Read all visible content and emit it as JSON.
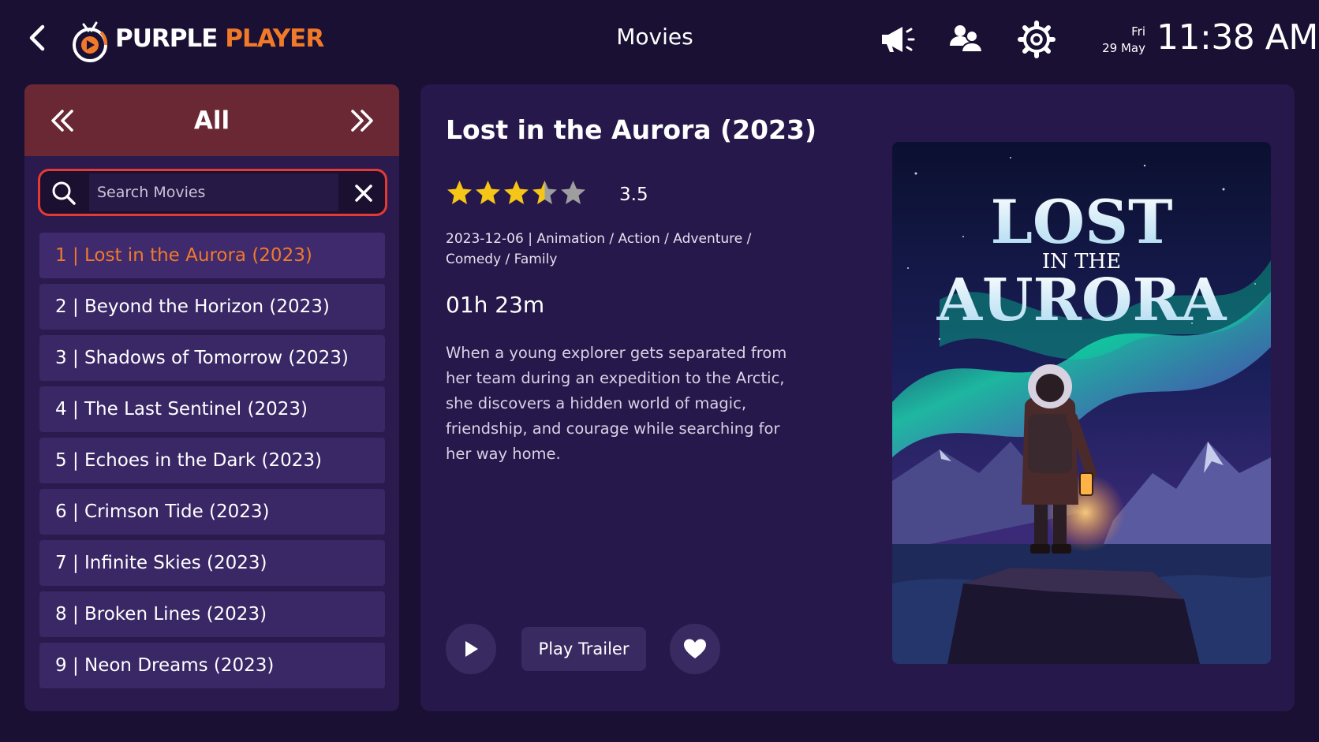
{
  "app": {
    "logo_part1": "PURPLE",
    "logo_part2": "PLAYER",
    "page_title": "Movies",
    "day": "Fri",
    "date": "29 May",
    "time": "11:38 AM",
    "icons": [
      "back-arrow-icon",
      "megaphone-icon",
      "users-icon",
      "gear-icon"
    ]
  },
  "category": {
    "title": "All"
  },
  "search": {
    "placeholder": "Search Movies",
    "value": ""
  },
  "movies": [
    {
      "label": "1 | Lost in the Aurora (2023)",
      "active": true
    },
    {
      "label": "2 | Beyond the Horizon (2023)"
    },
    {
      "label": "3 | Shadows of Tomorrow (2023)"
    },
    {
      "label": "4 | The Last Sentinel (2023)"
    },
    {
      "label": "5 | Echoes in the Dark (2023)"
    },
    {
      "label": "6 | Crimson Tide (2023)"
    },
    {
      "label": "7 | Infinite Skies (2023)"
    },
    {
      "label": "8 | Broken Lines (2023)"
    },
    {
      "label": "9 | Neon Dreams (2023)"
    }
  ],
  "detail": {
    "title": "Lost in the Aurora (2023)",
    "rating": 3.5,
    "rating_text": "3.5",
    "meta_line1": "2023-12-06 | Animation / Action / Adventure /",
    "meta_line2": "Comedy / Family",
    "duration": "01h 23m",
    "plot": "When a young explorer gets separated from her team during an expedition to the Arctic, she discovers a hidden world of magic, friendship, and courage while searching for her way home.",
    "trailer_label": "Play Trailer",
    "poster": {
      "line1": "LOST",
      "line2": "IN THE",
      "line3": "AURORA"
    }
  },
  "colors": {
    "background": "#1a1033",
    "accent_orange": "#f07a2a",
    "category_header": "#6a2835",
    "search_border": "#e53935",
    "star_yellow": "#f5c518",
    "star_grey": "#9e9e9e"
  }
}
